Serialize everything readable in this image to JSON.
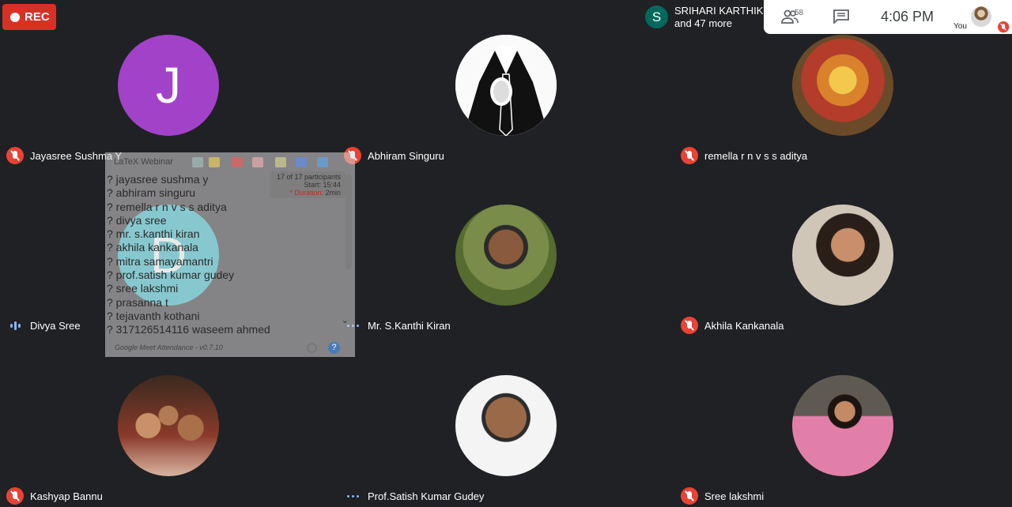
{
  "rec": {
    "label": "REC"
  },
  "presenter": {
    "initial": "S",
    "line1": "SRIHARI KARTHIK",
    "line2": "and 47 more"
  },
  "topbar": {
    "people_count": "58",
    "time": "4:06  PM",
    "you_label": "You"
  },
  "participants": [
    {
      "name": "Jayasree Sushma Y",
      "initial": "J",
      "color": "#a142c9",
      "status": "muted"
    },
    {
      "name": "Abhiram Singuru",
      "status": "none"
    },
    {
      "name": "remella r n v s s aditya",
      "status": "muted"
    },
    {
      "name": "Divya Sree",
      "initial": "D",
      "color": "#26b5c6",
      "status": "speaking"
    },
    {
      "name": "Mr. S.Kanthi Kiran",
      "status": "dots"
    },
    {
      "name": "Akhila Kankanala",
      "status": "muted"
    },
    {
      "name": "Kashyap Bannu",
      "status": "muted"
    },
    {
      "name": "Prof.Satish Kumar Gudey",
      "status": "dots"
    },
    {
      "name": "Sree lakshmi",
      "status": "muted"
    }
  ],
  "attendance": {
    "title": "LaTeX Webinar",
    "count": "17 of 17 participants",
    "start": "Start: 15:44",
    "duration_label": "* Duration:",
    "duration_value": "2min",
    "names": [
      "? jayasree sushma y",
      "? abhiram singuru",
      "? remella r n v s s aditya",
      "? divya sree",
      "? mr. s.kanthi kiran",
      "? akhila kankanala",
      "? mitra samayamantri",
      "? prof.satish kumar gudey",
      "? sree lakshmi",
      "? prasanna t",
      "? tejavanth kothani",
      "? 317126514116 waseem ahmed"
    ],
    "version": "Google Meet Attendance - v0.7.10"
  }
}
